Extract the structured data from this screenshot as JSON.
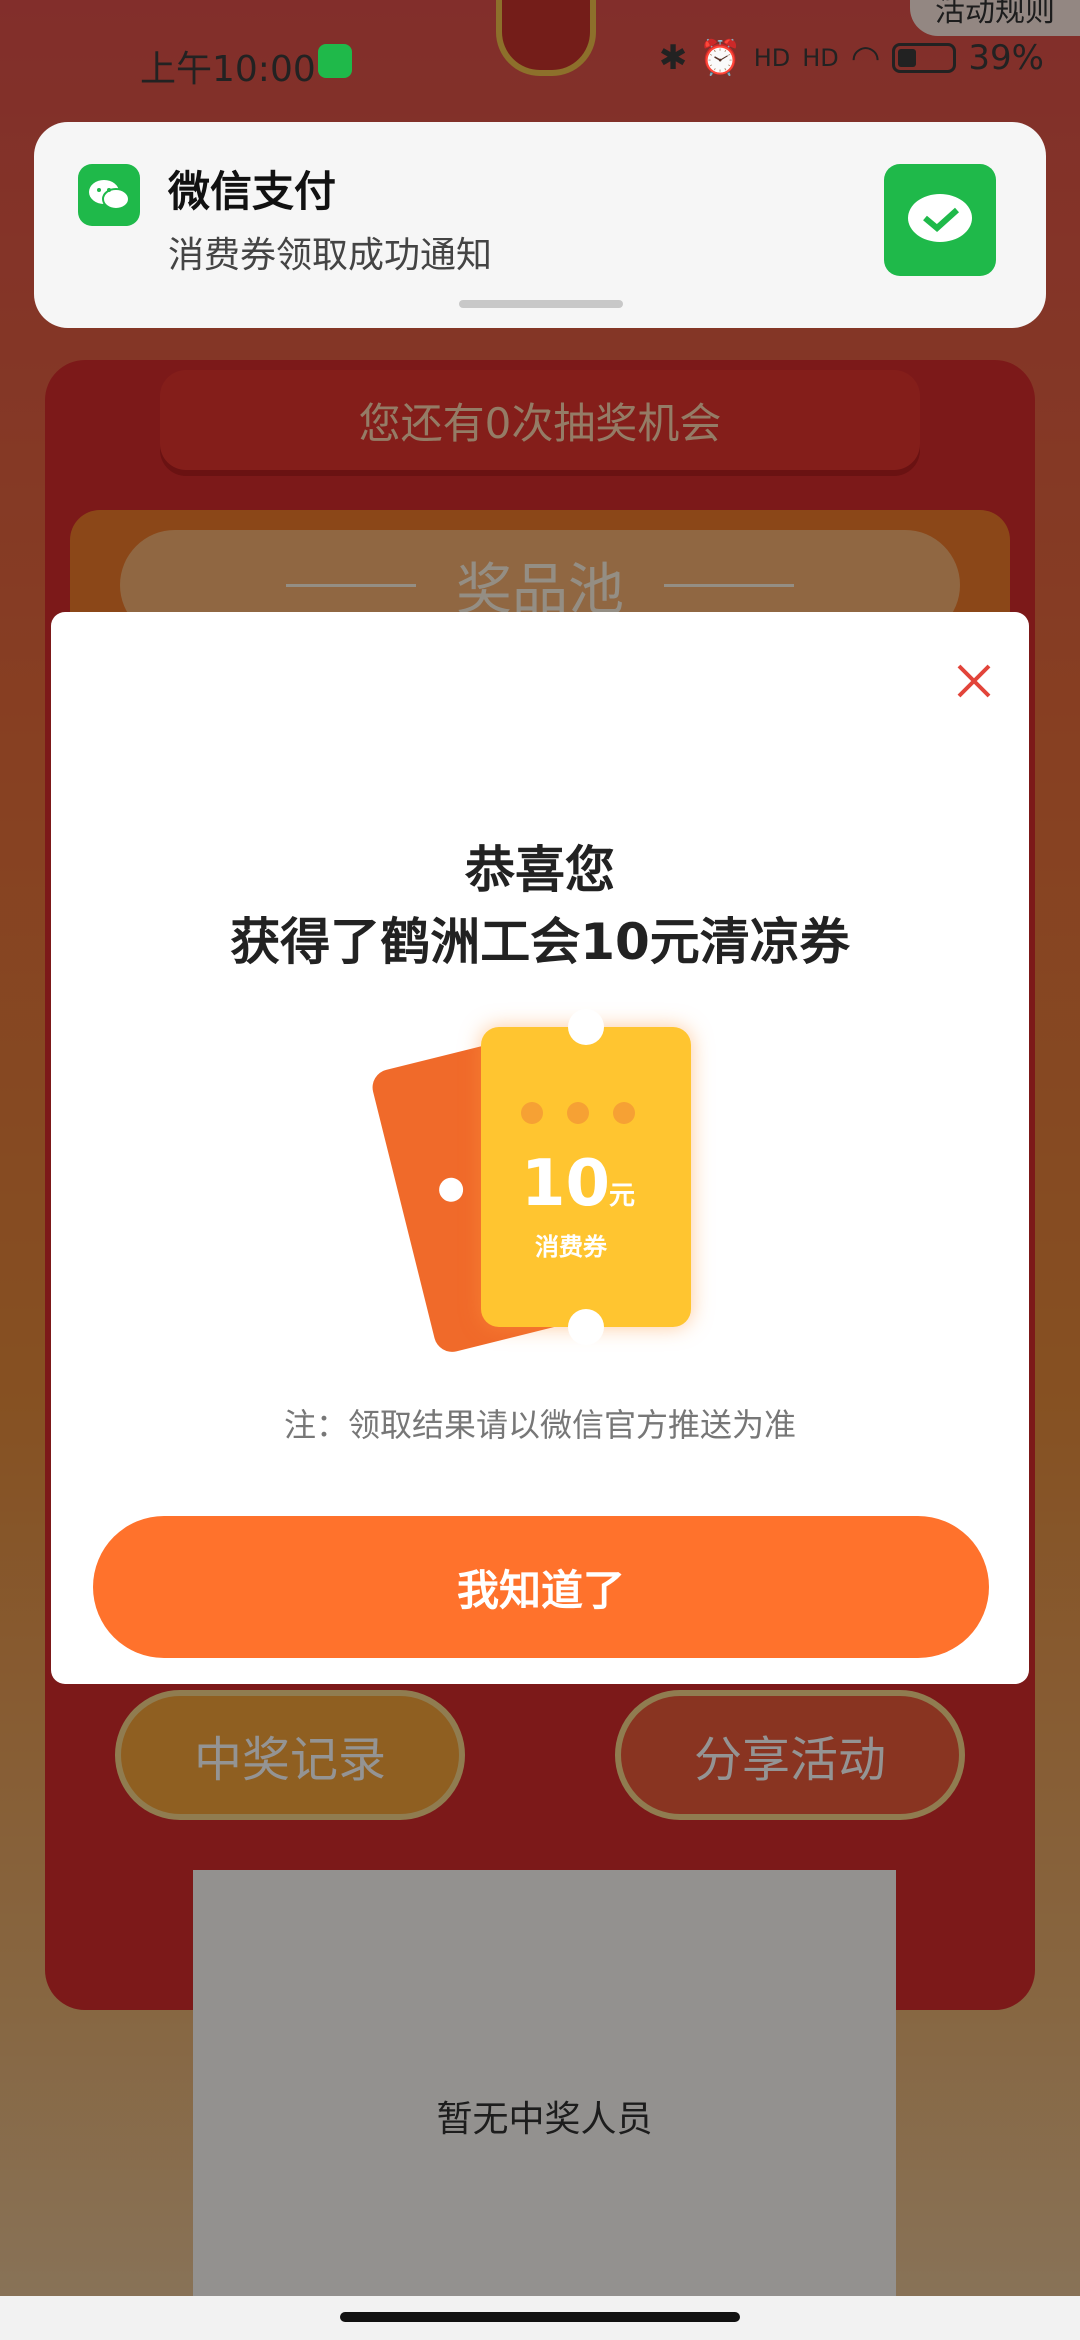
{
  "status_bar": {
    "time": "上午10:00",
    "battery": "39%",
    "signal_1": "HD",
    "signal_2": "HD"
  },
  "background": {
    "rules_button": "活动规则",
    "chances_text": "您还有0次抽奖机会",
    "prize_pool_title": "奖品池",
    "record_button": "中奖记录",
    "share_button": "分享活动",
    "winners_empty": "暂无中奖人员"
  },
  "notification": {
    "app_name": "微信支付",
    "message": "消费券领取成功通知",
    "app_icon": "wechat-icon",
    "thumbnail_icon": "wechat-pay-icon"
  },
  "modal": {
    "title_line1": "恭喜您",
    "title_line2": "获得了鹤洲工会10元清凉券",
    "coupon_value": "10",
    "coupon_unit": "元",
    "coupon_label": "消费券",
    "note": "注：领取结果请以微信官方推送为准",
    "confirm_button": "我知道了",
    "close_icon": "close-icon",
    "accent_color": "#ff722c"
  }
}
